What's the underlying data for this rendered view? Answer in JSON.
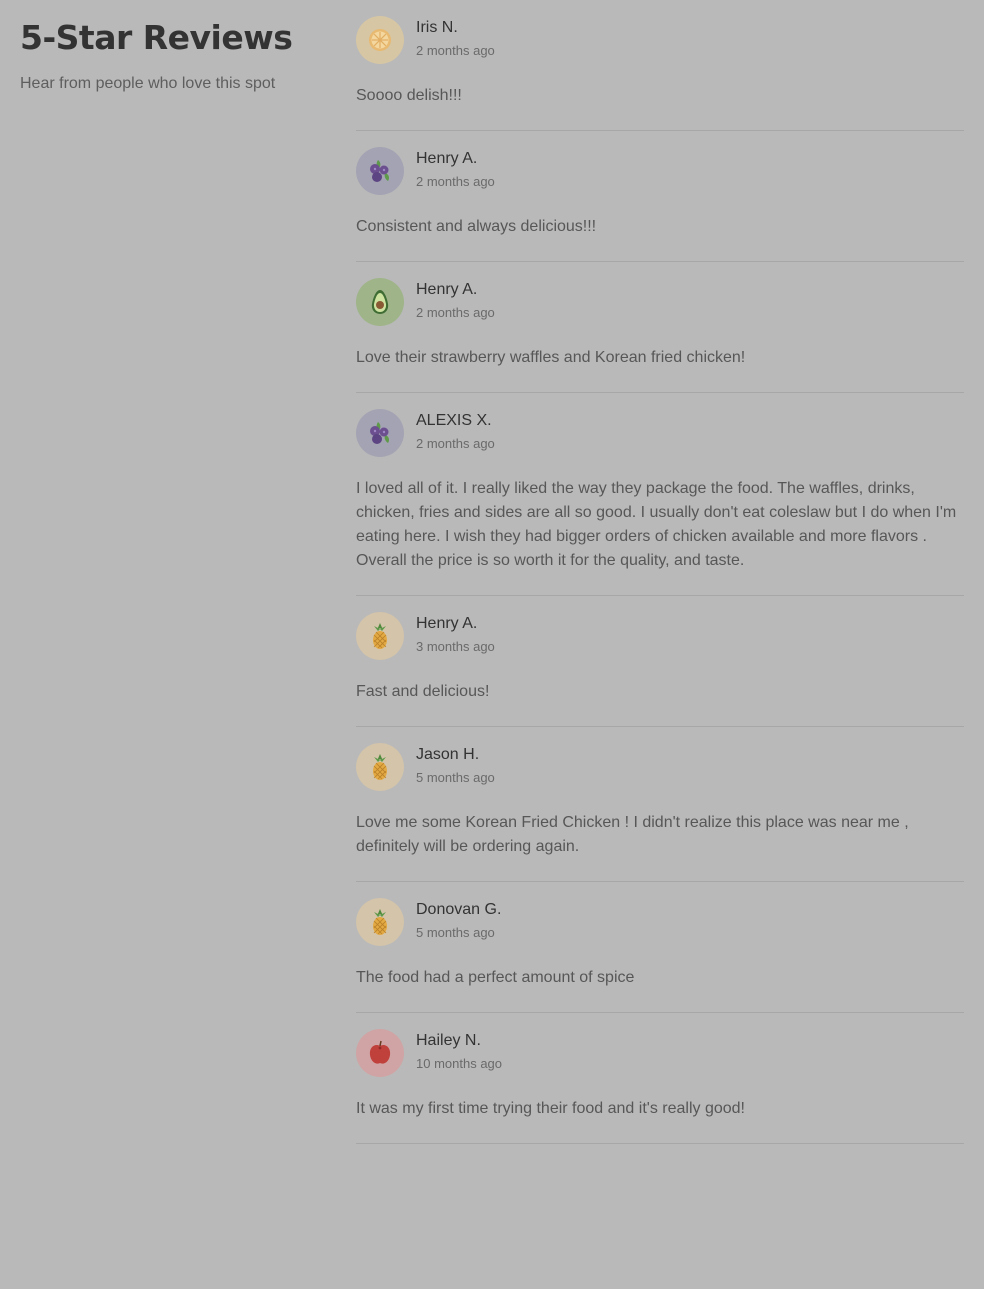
{
  "page": {
    "title": "5-Star Reviews",
    "subtitle": "Hear from people who love this spot"
  },
  "icon_colors": {
    "lemon": "#d6c6a4",
    "blueberry": "#a3a3b3",
    "avocado": "#9fb489",
    "pineapple": "#d3c4aa",
    "apple": "#d0a4a4"
  },
  "reviews": [
    {
      "name": "Iris N.",
      "date": "2 months ago",
      "text": "Soooo delish!!!",
      "avatar": "lemon-icon"
    },
    {
      "name": "Henry A.",
      "date": "2 months ago",
      "text": "Consistent and always delicious!!!",
      "avatar": "blueberry-icon"
    },
    {
      "name": "Henry A.",
      "date": "2 months ago",
      "text": "Love their strawberry waffles and Korean fried chicken!",
      "avatar": "avocado-icon"
    },
    {
      "name": "ALEXIS X.",
      "date": "2 months ago",
      "text": "I loved all of it. I really liked the way they package the food. The waffles, drinks, chicken, fries and sides are all so good. I usually don't eat coleslaw but I do when I'm eating here. I wish they had bigger orders of chicken available and more flavors . Overall the price is so worth it for the quality, and taste.",
      "avatar": "blueberry-icon"
    },
    {
      "name": "Henry A.",
      "date": "3 months ago",
      "text": "Fast and delicious!",
      "avatar": "pineapple-icon"
    },
    {
      "name": "Jason H.",
      "date": "5 months ago",
      "text": "Love me some Korean Fried Chicken ! I didn't realize this place was near me , definitely will be ordering again.",
      "avatar": "pineapple-icon"
    },
    {
      "name": "Donovan G.",
      "date": "5 months ago",
      "text": "The food had a perfect amount of spice",
      "avatar": "pineapple-icon"
    },
    {
      "name": "Hailey N.",
      "date": "10 months ago",
      "text": "It was my first time trying their food and it's really good!",
      "avatar": "apple-icon"
    }
  ]
}
